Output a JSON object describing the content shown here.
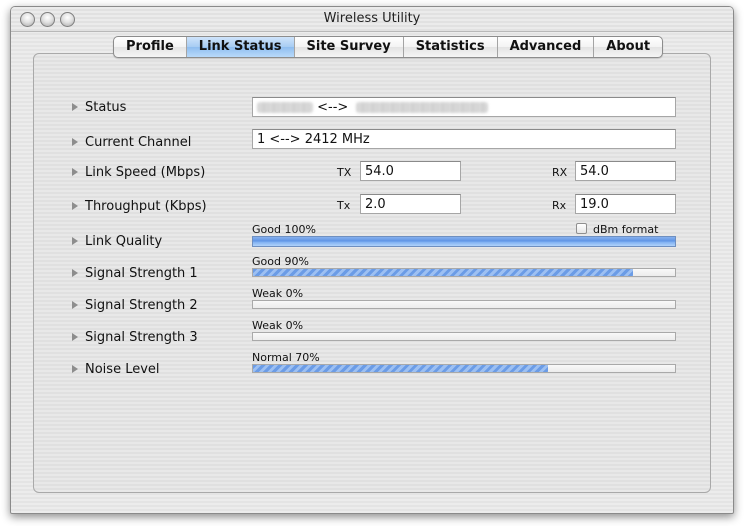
{
  "window": {
    "title": "Wireless Utility"
  },
  "tabs": [
    {
      "label": "Profile",
      "active": false
    },
    {
      "label": "Link Status",
      "active": true
    },
    {
      "label": "Site Survey",
      "active": false
    },
    {
      "label": "Statistics",
      "active": false
    },
    {
      "label": "Advanced",
      "active": false
    },
    {
      "label": "About",
      "active": false
    }
  ],
  "status": {
    "label": "Status",
    "value_arrow": "<-->"
  },
  "current_channel": {
    "label": "Current Channel",
    "value": "1 <--> 2412 MHz"
  },
  "link_speed": {
    "label": "Link Speed (Mbps)",
    "tx_label": "TX",
    "tx_value": "54.0",
    "rx_label": "RX",
    "rx_value": "54.0"
  },
  "throughput": {
    "label": "Throughput (Kbps)",
    "tx_label": "Tx",
    "tx_value": "2.0",
    "rx_label": "Rx",
    "rx_value": "19.0"
  },
  "link_quality": {
    "label": "Link Quality",
    "meter_text": "Good 100%",
    "percent": 100,
    "dbm_format_label": "dBm format",
    "dbm_format_checked": false
  },
  "signal_strength_1": {
    "label": "Signal Strength 1",
    "meter_text": "Good 90%",
    "percent": 90
  },
  "signal_strength_2": {
    "label": "Signal Strength 2",
    "meter_text": "Weak 0%",
    "percent": 0
  },
  "signal_strength_3": {
    "label": "Signal Strength 3",
    "meter_text": "Weak 0%",
    "percent": 0
  },
  "noise_level": {
    "label": "Noise Level",
    "meter_text": "Normal 70%",
    "percent": 70
  },
  "colors": {
    "meter_fill": "#6b9ce6",
    "tab_active": "#a7ccf3"
  }
}
